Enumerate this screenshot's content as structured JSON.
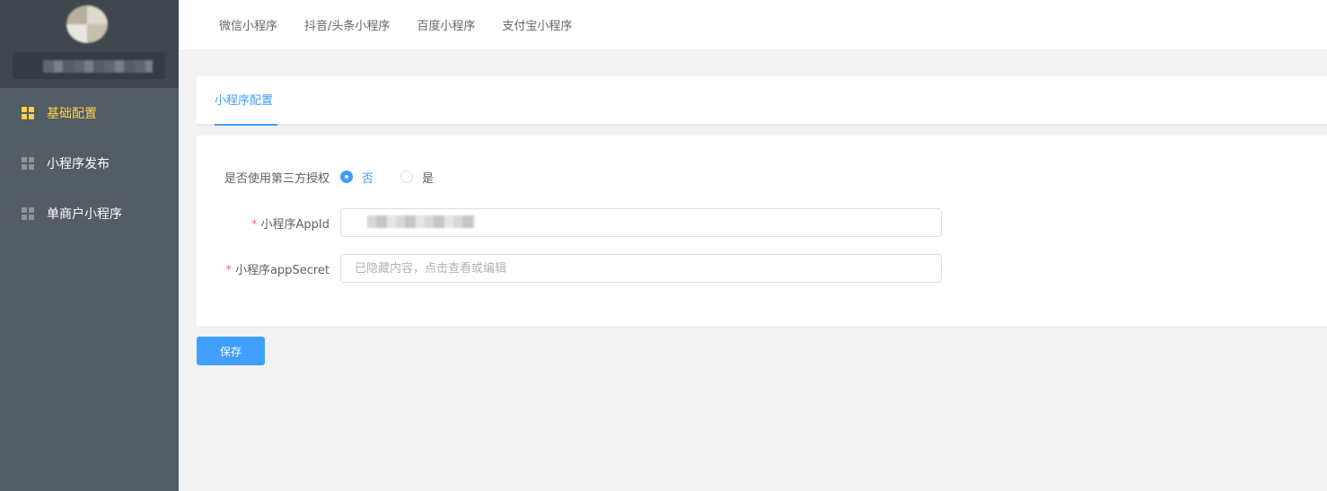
{
  "sidebar": {
    "items": [
      {
        "label": "基础配置",
        "icon": "grid-icon",
        "active": true
      },
      {
        "label": "小程序发布",
        "icon": "grid-icon",
        "active": false
      },
      {
        "label": "单商户小程序",
        "icon": "grid-icon",
        "active": false
      }
    ]
  },
  "topnav": {
    "tabs": [
      "微信小程序",
      "抖音/头条小程序",
      "百度小程序",
      "支付宝小程序"
    ]
  },
  "content": {
    "active_tab": "小程序配置",
    "form": {
      "third_party_label": "是否使用第三方授权",
      "third_party_options": [
        "否",
        "是"
      ],
      "third_party_selected": "否",
      "appid_label": "小程序AppId",
      "appid_required": "*",
      "appsecret_label": "小程序appSecret",
      "appsecret_required": "*",
      "appsecret_placeholder": "已隐藏内容，点击查看或编辑"
    },
    "save_label": "保存"
  },
  "colors": {
    "sidebar_bg": "#545c64",
    "active_menu": "#ffd04b",
    "primary": "#409eff",
    "required": "#f56c6c"
  }
}
